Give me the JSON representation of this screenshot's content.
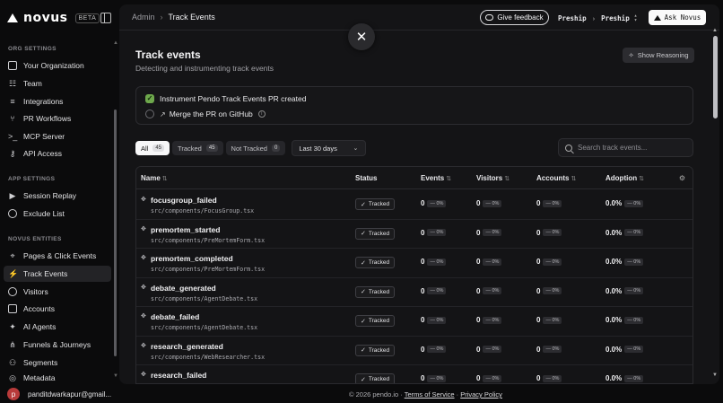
{
  "brand": {
    "name": "novus",
    "badge": "BETA"
  },
  "sidebar": {
    "sections": [
      {
        "title": "ORG SETTINGS",
        "items": [
          {
            "label": "Your Organization",
            "icon": "id-card-icon"
          },
          {
            "label": "Team",
            "icon": "team-icon"
          },
          {
            "label": "Integrations",
            "icon": "sliders-icon"
          },
          {
            "label": "PR Workflows",
            "icon": "git-branch-icon"
          },
          {
            "label": "MCP Server",
            "icon": "terminal-icon"
          },
          {
            "label": "API Access",
            "icon": "key-icon"
          }
        ]
      },
      {
        "title": "APP SETTINGS",
        "items": [
          {
            "label": "Session Replay",
            "icon": "replay-icon"
          },
          {
            "label": "Exclude List",
            "icon": "shield-icon"
          }
        ]
      },
      {
        "title": "NOVUS ENTITIES",
        "items": [
          {
            "label": "Pages & Click Events",
            "icon": "pointer-icon"
          },
          {
            "label": "Track Events",
            "icon": "bolt-icon"
          },
          {
            "label": "Visitors",
            "icon": "user-icon"
          },
          {
            "label": "Accounts",
            "icon": "building-icon"
          },
          {
            "label": "AI Agents",
            "icon": "bot-icon"
          },
          {
            "label": "Funnels & Journeys",
            "icon": "funnel-icon"
          },
          {
            "label": "Segments",
            "icon": "segments-icon"
          },
          {
            "label": "Metadata",
            "icon": "database-icon"
          }
        ]
      }
    ]
  },
  "topbar": {
    "breadcrumb": [
      "Admin",
      "Track Events"
    ],
    "feedback_label": "Give feedback",
    "org": [
      "Preship",
      "Preship"
    ],
    "ask_label": "Ask Novus"
  },
  "page": {
    "title": "Track events",
    "subtitle": "Detecting and instrumenting track events",
    "reason_label": "Show Reasoning"
  },
  "checklist": [
    {
      "label": "Instrument Pendo Track Events PR created",
      "done": true
    },
    {
      "label": "Merge the PR on GitHub",
      "done": false
    }
  ],
  "filters": {
    "tabs": [
      {
        "label": "All",
        "count": "45"
      },
      {
        "label": "Tracked",
        "count": "45"
      },
      {
        "label": "Not Tracked",
        "count": "0"
      }
    ],
    "range": "Last 30 days",
    "search_placeholder": "Search track events..."
  },
  "table": {
    "columns": [
      "Name",
      "Status",
      "Events",
      "Visitors",
      "Accounts",
      "Adoption"
    ],
    "rows": [
      {
        "name": "focusgroup_failed",
        "path": "src/components/FocusGroup.tsx",
        "status": "Tracked",
        "events": "0",
        "visitors": "0",
        "accounts": "0",
        "adoption": "0.0%",
        "delta": "— 0%"
      },
      {
        "name": "premortem_started",
        "path": "src/components/PreMortemForm.tsx",
        "status": "Tracked",
        "events": "0",
        "visitors": "0",
        "accounts": "0",
        "adoption": "0.0%",
        "delta": "— 0%"
      },
      {
        "name": "premortem_completed",
        "path": "src/components/PreMortemForm.tsx",
        "status": "Tracked",
        "events": "0",
        "visitors": "0",
        "accounts": "0",
        "adoption": "0.0%",
        "delta": "— 0%"
      },
      {
        "name": "debate_generated",
        "path": "src/components/AgentDebate.tsx",
        "status": "Tracked",
        "events": "0",
        "visitors": "0",
        "accounts": "0",
        "adoption": "0.0%",
        "delta": "— 0%"
      },
      {
        "name": "debate_failed",
        "path": "src/components/AgentDebate.tsx",
        "status": "Tracked",
        "events": "0",
        "visitors": "0",
        "accounts": "0",
        "adoption": "0.0%",
        "delta": "— 0%"
      },
      {
        "name": "research_generated",
        "path": "src/components/WebResearcher.tsx",
        "status": "Tracked",
        "events": "0",
        "visitors": "0",
        "accounts": "0",
        "adoption": "0.0%",
        "delta": "— 0%"
      },
      {
        "name": "research_failed",
        "path": "",
        "status": "Tracked",
        "events": "0",
        "visitors": "0",
        "accounts": "0",
        "adoption": "0.0%",
        "delta": "— 0%"
      }
    ]
  },
  "footer": {
    "user_initial": "p",
    "user_email": "panditdwarkapur@gmail...",
    "copyright": "© 2026 pendo.io · ",
    "terms": "Terms of Service",
    "dot": " · ",
    "privacy": "Privacy Policy"
  }
}
